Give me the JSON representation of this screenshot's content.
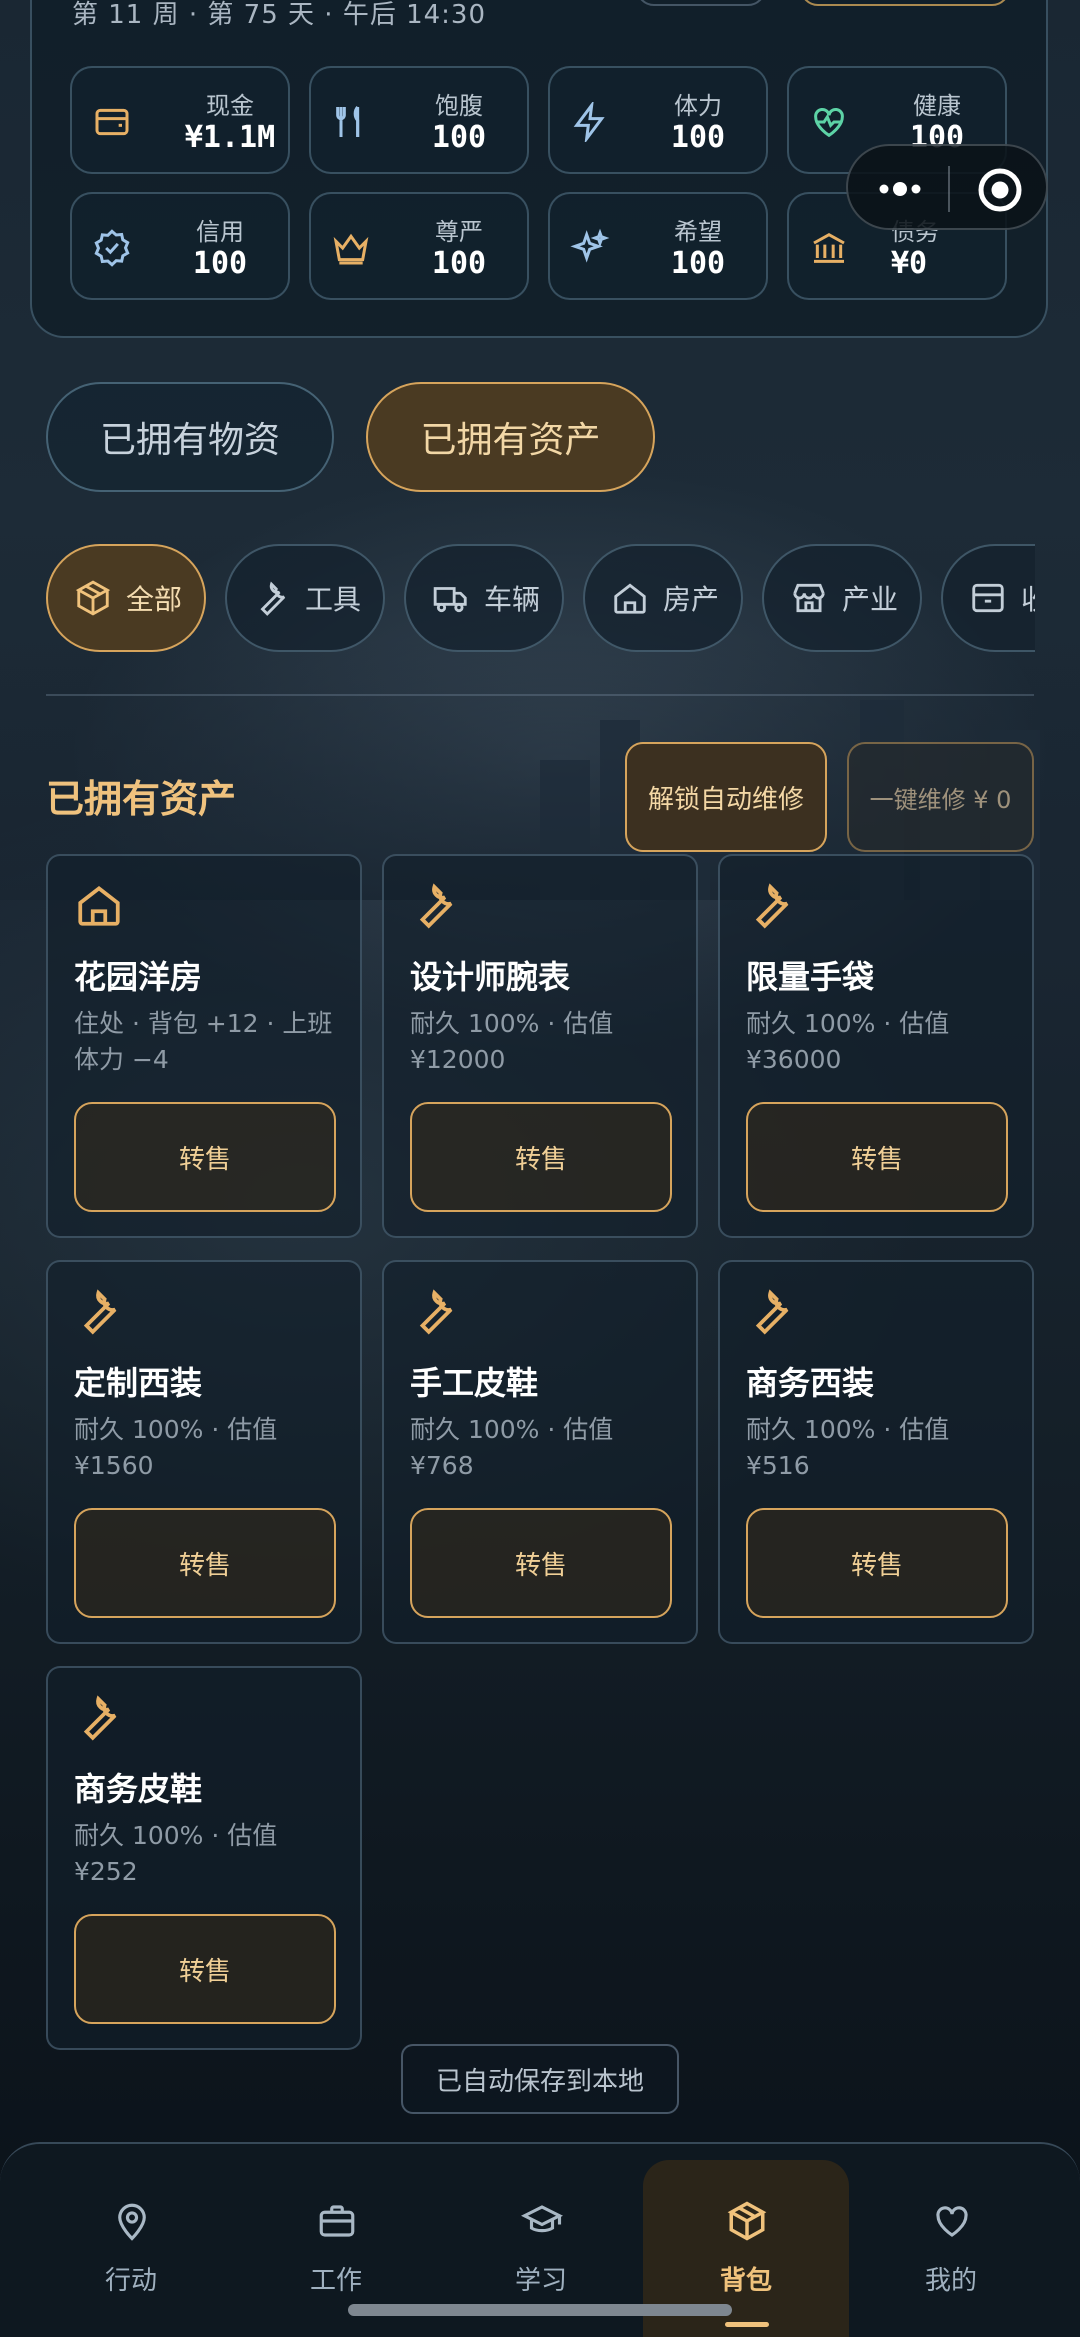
{
  "header": {
    "subtitle": "第 11 周 · 第 75 天 · 午后 14:30"
  },
  "stats": [
    {
      "label": "现金",
      "value": "¥1.1M",
      "icon": "wallet-icon"
    },
    {
      "label": "饱腹",
      "value": "100",
      "icon": "utensils-icon"
    },
    {
      "label": "体力",
      "value": "100",
      "icon": "bolt-icon"
    },
    {
      "label": "健康",
      "value": "100",
      "icon": "heart-pulse-icon"
    },
    {
      "label": "信用",
      "value": "100",
      "icon": "badge-check-icon"
    },
    {
      "label": "尊严",
      "value": "100",
      "icon": "crown-icon"
    },
    {
      "label": "希望",
      "value": "100",
      "icon": "sparkles-icon"
    },
    {
      "label": "债务",
      "value": "¥0",
      "icon": "bank-icon"
    }
  ],
  "main_tabs": [
    {
      "label": "已拥有物资"
    },
    {
      "label": "已拥有资产"
    }
  ],
  "categories": [
    {
      "label": "全部",
      "icon": "box-icon"
    },
    {
      "label": "工具",
      "icon": "wrench-icon"
    },
    {
      "label": "车辆",
      "icon": "truck-icon"
    },
    {
      "label": "房产",
      "icon": "house-icon"
    },
    {
      "label": "产业",
      "icon": "store-icon"
    },
    {
      "label": "收",
      "icon": "archive-icon"
    }
  ],
  "section": {
    "title": "已拥有资产",
    "unlock_label": "解锁自动维修",
    "repair_label": "一键维修 ¥ 0"
  },
  "assets": [
    {
      "name": "花园洋房",
      "desc": "住处 · 背包 +12 · 上班体力 −4",
      "sell": "转售",
      "icon": "house-icon"
    },
    {
      "name": "设计师腕表",
      "desc": "耐久 100% · 估值 ¥12000",
      "sell": "转售",
      "icon": "wrench-icon"
    },
    {
      "name": "限量手袋",
      "desc": "耐久 100% · 估值 ¥36000",
      "sell": "转售",
      "icon": "wrench-icon"
    },
    {
      "name": "定制西装",
      "desc": "耐久 100% · 估值 ¥1560",
      "sell": "转售",
      "icon": "wrench-icon"
    },
    {
      "name": "手工皮鞋",
      "desc": "耐久 100% · 估值 ¥768",
      "sell": "转售",
      "icon": "wrench-icon"
    },
    {
      "name": "商务西装",
      "desc": "耐久 100% · 估值 ¥516",
      "sell": "转售",
      "icon": "wrench-icon"
    },
    {
      "name": "商务皮鞋",
      "desc": "耐久 100% · 估值 ¥252",
      "sell": "转售",
      "icon": "wrench-icon"
    }
  ],
  "saved_label": "已自动保存到本地",
  "nav": [
    {
      "label": "行动",
      "icon": "map-pin-icon"
    },
    {
      "label": "工作",
      "icon": "briefcase-icon"
    },
    {
      "label": "学习",
      "icon": "graduation-cap-icon"
    },
    {
      "label": "背包",
      "icon": "box-icon"
    },
    {
      "label": "我的",
      "icon": "heart-icon"
    }
  ],
  "colors": {
    "accent": "#d6a45c",
    "accent_text": "#efc27e",
    "background": "#0d1620"
  }
}
